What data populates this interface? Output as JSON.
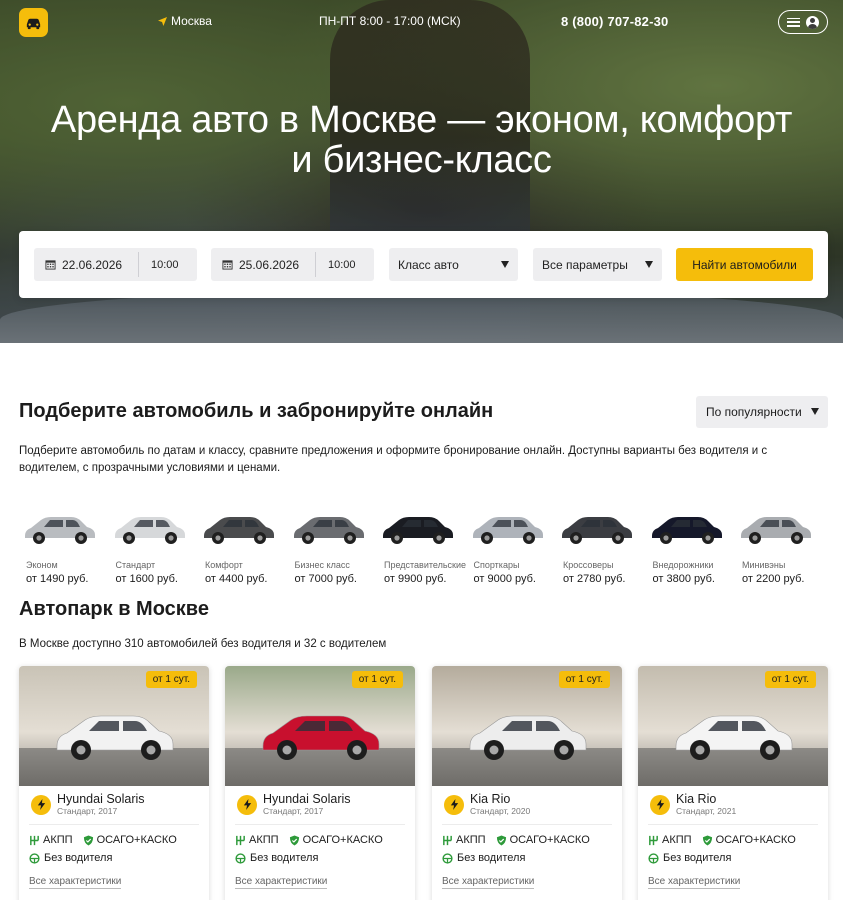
{
  "header": {
    "city": "Москва",
    "hours": "ПН-ПТ 8:00 - 17:00 (МСК)",
    "phone": "8 (800) 707-82-30"
  },
  "hero": {
    "title_line1": "Аренда авто в Москве — эконом, комфорт",
    "title_line2": "и бизнес-класс"
  },
  "search": {
    "pickup_date": "22.06.2026",
    "pickup_time": "10:00",
    "return_date": "25.06.2026",
    "return_time": "10:00",
    "car_class": "Класс авто",
    "params": "Все параметры",
    "submit": "Найти автомобили"
  },
  "section": {
    "title": "Подберите автомобиль и забронируйте онлайн",
    "sort": "По популярности",
    "intro": "Подберите автомобиль по датам и классу, сравните предложения и оформите бронирование онлайн. Доступны варианты без водителя и с водителем, с прозрачными условиями и ценами."
  },
  "classes": [
    {
      "name": "Эконом",
      "price": "от 1490 руб.",
      "color": "#b9bcc0"
    },
    {
      "name": "Стандарт",
      "price": "от 1600 руб.",
      "color": "#d6d8da"
    },
    {
      "name": "Комфорт",
      "price": "от 4400 руб.",
      "color": "#4a4b4d"
    },
    {
      "name": "Бизнес класс",
      "price": "от 7000 руб.",
      "color": "#6a6c70"
    },
    {
      "name": "Представительские",
      "price": "от 9900 руб.",
      "color": "#1a1c22"
    },
    {
      "name": "Спорткары",
      "price": "от 9000 руб.",
      "color": "#aeb3ba"
    },
    {
      "name": "Кроссоверы",
      "price": "от 2780 руб.",
      "color": "#3b3d42"
    },
    {
      "name": "Внедорожники",
      "price": "от 3800 руб.",
      "color": "#15182a"
    },
    {
      "name": "Минивэны",
      "price": "от 2200 руб.",
      "color": "#a9acb0"
    }
  ],
  "fleet": {
    "title": "Автопарк в Москве",
    "subtitle": "В Москве доступно 310 автомобилей без водителя и 32 с водителем"
  },
  "cards": [
    {
      "badge": "от 1 сут.",
      "model": "Hyundai Solaris",
      "spec": "Стандарт, 2017",
      "transmission": "АКПП",
      "insurance": "ОСАГО+КАСКО",
      "driver": "Без водителя",
      "link": "Все характеристики",
      "car_color": "#f2f2f2",
      "bg": "#c9c3b6"
    },
    {
      "badge": "от 1 сут.",
      "model": "Hyundai Solaris",
      "spec": "Стандарт, 2017",
      "transmission": "АКПП",
      "insurance": "ОСАГО+КАСКО",
      "driver": "Без водителя",
      "link": "Все характеристики",
      "car_color": "#c8102e",
      "bg": "#9aa98a"
    },
    {
      "badge": "от 1 сут.",
      "model": "Kia Rio",
      "spec": "Стандарт, 2020",
      "transmission": "АКПП",
      "insurance": "ОСАГО+КАСКО",
      "driver": "Без водителя",
      "link": "Все характеристики",
      "car_color": "#ededed",
      "bg": "#b4ab9c"
    },
    {
      "badge": "от 1 сут.",
      "model": "Kia Rio",
      "spec": "Стандарт, 2021",
      "transmission": "АКПП",
      "insurance": "ОСАГО+КАСКО",
      "driver": "Без водителя",
      "link": "Все характеристики",
      "car_color": "#f4f4f4",
      "bg": "#c3bcae"
    }
  ],
  "colors": {
    "accent": "#f5bd0b",
    "feature_green": "#2e9a3a"
  }
}
